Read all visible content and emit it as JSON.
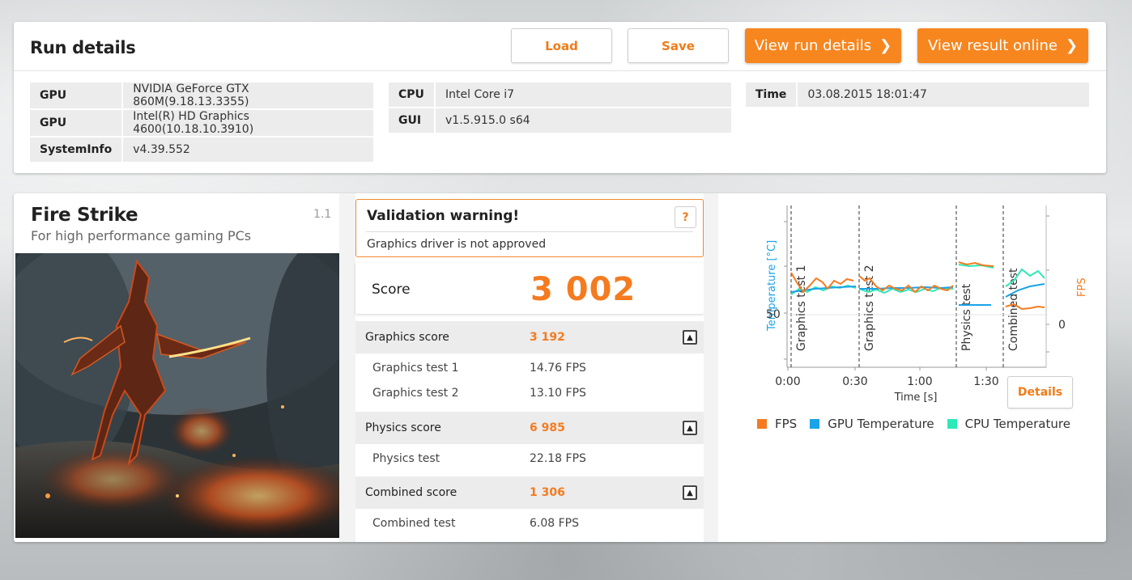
{
  "run": {
    "title": "Run details",
    "load_label": "Load",
    "save_label": "Save",
    "view_run_label": "View run details",
    "view_online_label": "View result online",
    "info_left": [
      {
        "key": "GPU",
        "value": "NVIDIA GeForce GTX 860M(9.18.13.3355)"
      },
      {
        "key": "GPU",
        "value": "Intel(R) HD Graphics 4600(10.18.10.3910)"
      },
      {
        "key": "SystemInfo",
        "value": "v4.39.552"
      }
    ],
    "info_mid": [
      {
        "key": "CPU",
        "value": "Intel Core i7"
      },
      {
        "key": "GUI",
        "value": "v1.5.915.0 s64"
      }
    ],
    "info_right": [
      {
        "key": "Time",
        "value": "03.08.2015 18:01:47"
      }
    ]
  },
  "benchmark": {
    "title": "Fire Strike",
    "subtitle": "For high performance gaming PCs",
    "version": "1.1",
    "validation_title": "Validation warning!",
    "validation_help": "?",
    "validation_text": "Graphics driver is not approved",
    "score_label": "Score",
    "score_value": "3 002",
    "graphics_label": "Graphics score",
    "graphics_value": "3 192",
    "gt1_label": "Graphics test 1",
    "gt1_value": "14.76 FPS",
    "gt2_label": "Graphics test 2",
    "gt2_value": "13.10 FPS",
    "physics_label": "Physics score",
    "physics_value": "6 985",
    "pt_label": "Physics test",
    "pt_value": "22.18 FPS",
    "combined_label": "Combined score",
    "combined_value": "1 306",
    "ct_label": "Combined test",
    "ct_value": "6.08 FPS",
    "details_label": "Details"
  },
  "chart": {
    "left_axis_label": "Temperature [°C]",
    "right_axis_label": "FPS",
    "x_axis_label": "Time [s]",
    "x_ticks": [
      "0:00",
      "0:30",
      "1:00",
      "1:30"
    ],
    "left_tick": "50",
    "right_tick": "0",
    "sections": [
      "Graphics test 1",
      "Graphics test 2",
      "Physics test",
      "Combined test"
    ],
    "legend": [
      {
        "label": "FPS",
        "color": "#f47b20"
      },
      {
        "label": "GPU Temperature",
        "color": "#1aa3e8"
      },
      {
        "label": "CPU Temperature",
        "color": "#2ee8b8"
      }
    ],
    "colors": {
      "fps": "#f47b20",
      "gpu": "#1aa3e8",
      "cpu": "#2ee8b8"
    }
  }
}
